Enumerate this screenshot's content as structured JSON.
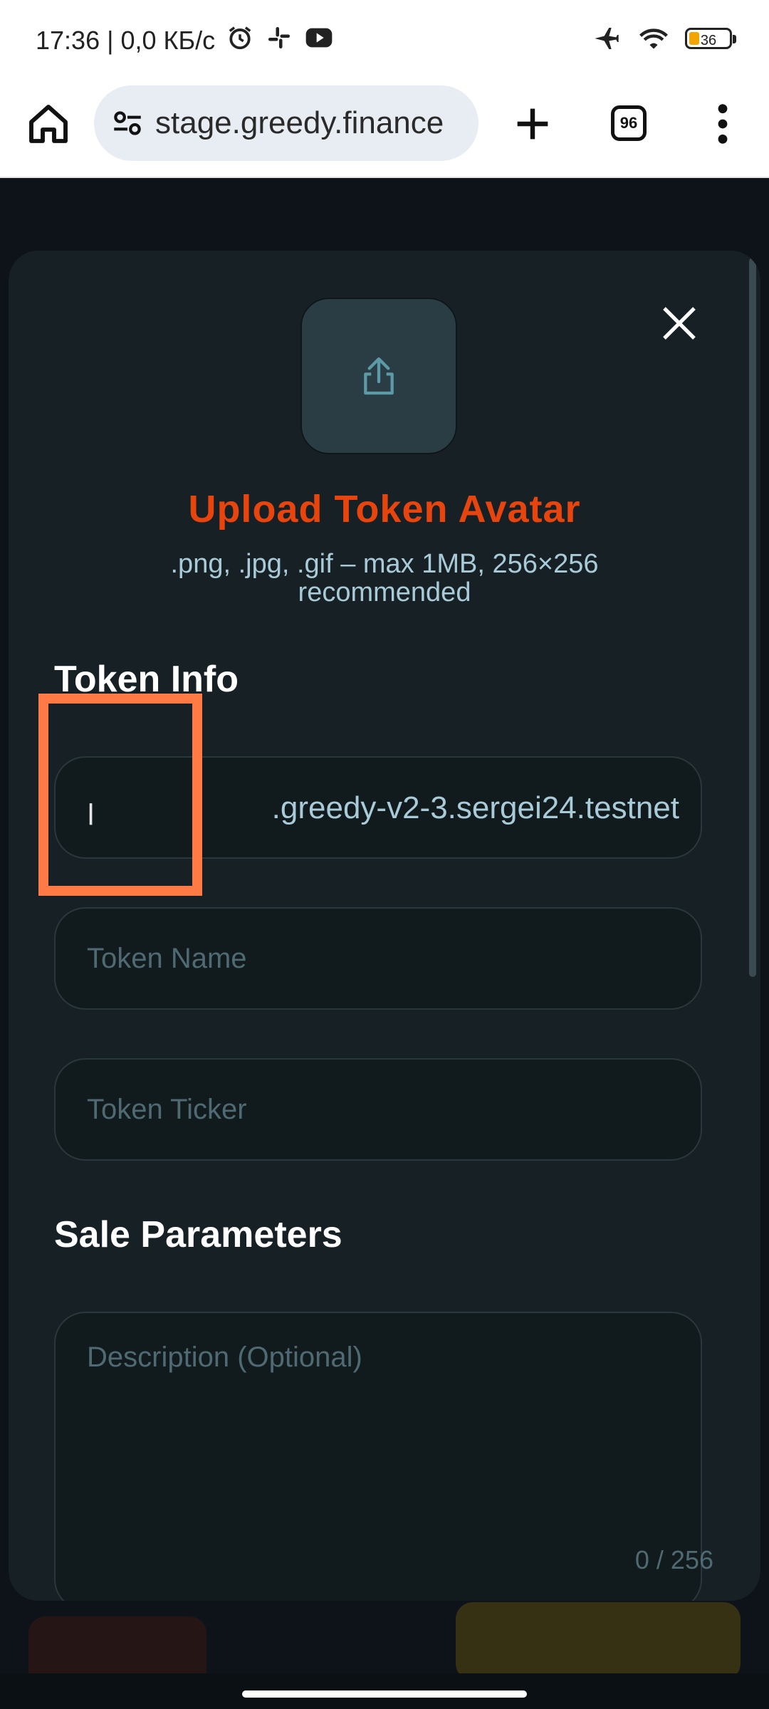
{
  "status_bar": {
    "time_net": "17:36 | 0,0 КБ/с",
    "battery": "36"
  },
  "browser": {
    "url": "stage.greedy.finance",
    "tab_count": "96"
  },
  "modal": {
    "upload_title": "Upload Token Avatar",
    "upload_hint": ".png, .jpg, .gif – max 1MB, 256×256 recommended",
    "token_info_title": "Token Info",
    "address_value": ".greedy-v2-3.sergei24.testnet",
    "token_name_placeholder": "Token Name",
    "token_ticker_placeholder": "Token Ticker",
    "sale_params_title": "Sale Parameters",
    "description_placeholder": "Description (Optional)",
    "char_count": "0 / 256"
  },
  "colors": {
    "accent": "#e8450e",
    "highlight": "#ff7a45",
    "modal_bg": "#172125",
    "hint_text": "#a9cbd8"
  }
}
